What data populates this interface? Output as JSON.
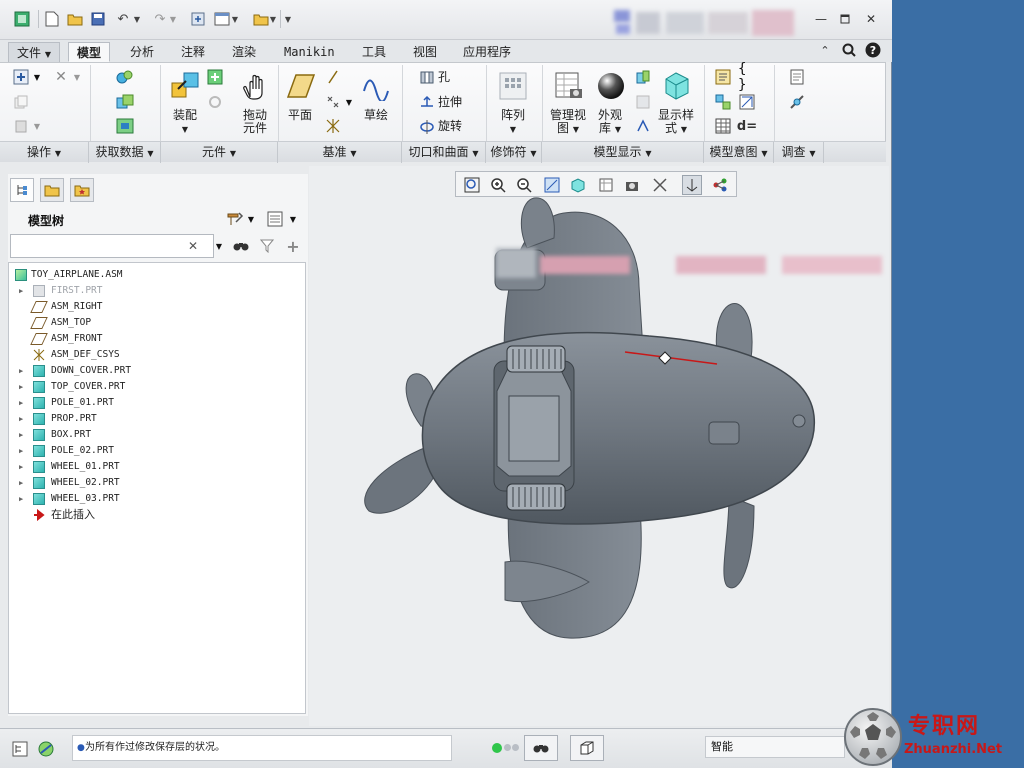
{
  "titlebar": {
    "quick_access": [
      "app-icon",
      "new-icon",
      "open-icon",
      "save-icon",
      "undo-icon",
      "redo-icon",
      "regenerate-icon",
      "windows-icon",
      "close-window-icon",
      "customize-icon"
    ],
    "window_controls": [
      "minimize-icon",
      "restore-icon",
      "close-icon"
    ]
  },
  "tabs": {
    "file": "文件",
    "model": "模型",
    "analysis": "分析",
    "annotate": "注释",
    "render": "渲染",
    "manikin": "Manikin",
    "tools": "工具",
    "view": "视图",
    "applications": "应用程序"
  },
  "ribbon": {
    "assembly_label": "装配",
    "drag_label": "拖动\n元件",
    "drag_line1": "拖动",
    "drag_line2": "元件",
    "plane_label": "平面",
    "sketch_label": "草绘",
    "hole_label": "孔",
    "extrude_label": "拉伸",
    "revolve_label": "旋转",
    "pattern_label": "阵列",
    "manage_view_line1": "管理视",
    "manage_view_line2": "图",
    "appearance_line1": "外观",
    "appearance_line2": "库",
    "display_style_line1": "显示样",
    "display_style_line2": "式",
    "groups": {
      "operations": "操作",
      "get_data": "获取数据",
      "components": "元件",
      "datum": "基准",
      "cut_surface": "切口和曲面",
      "modifiers": "修饰符",
      "model_display": "模型显示",
      "model_intent": "模型意图",
      "investigate": "调查"
    }
  },
  "left_panel": {
    "title": "模型树",
    "search_value": "",
    "tree": [
      {
        "name": "TOY_AIRPLANE.ASM",
        "kind": "asm",
        "arrow": false
      },
      {
        "name": "FIRST.PRT",
        "kind": "part-grey",
        "arrow": true
      },
      {
        "name": "ASM_RIGHT",
        "kind": "plane",
        "arrow": false
      },
      {
        "name": "ASM_TOP",
        "kind": "plane",
        "arrow": false
      },
      {
        "name": "ASM_FRONT",
        "kind": "plane",
        "arrow": false
      },
      {
        "name": "ASM_DEF_CSYS",
        "kind": "csys",
        "arrow": false
      },
      {
        "name": "DOWN_COVER.PRT",
        "kind": "part",
        "arrow": true
      },
      {
        "name": "TOP_COVER.PRT",
        "kind": "part",
        "arrow": true
      },
      {
        "name": "POLE_01.PRT",
        "kind": "part",
        "arrow": true
      },
      {
        "name": "PROP.PRT",
        "kind": "part",
        "arrow": true
      },
      {
        "name": "BOX.PRT",
        "kind": "part",
        "arrow": true
      },
      {
        "name": "POLE_02.PRT",
        "kind": "part",
        "arrow": true
      },
      {
        "name": "WHEEL_01.PRT",
        "kind": "part",
        "arrow": true
      },
      {
        "name": "WHEEL_02.PRT",
        "kind": "part",
        "arrow": true
      },
      {
        "name": "WHEEL_03.PRT",
        "kind": "part",
        "arrow": true
      },
      {
        "name": "在此插入",
        "kind": "insert",
        "arrow": false
      }
    ]
  },
  "status": {
    "message": "为所有作过修改保存层的状况。",
    "filter": "智能"
  },
  "watermark": {
    "cn": "专职网",
    "en": "Zhuanzhi.Net"
  },
  "colors": {
    "desktop": "#3a6ea5",
    "model_body": "#6f7780",
    "accent_red": "#c81818"
  }
}
